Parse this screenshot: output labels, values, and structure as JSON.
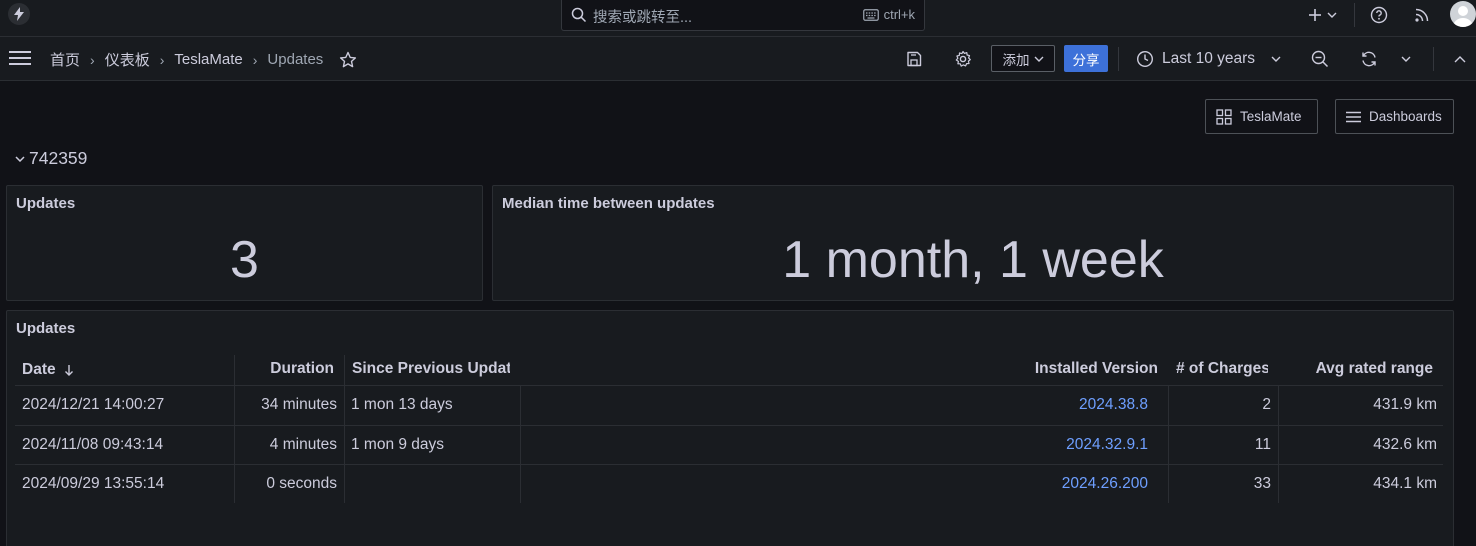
{
  "topbar": {
    "search_placeholder": "搜索或跳转至...",
    "search_shortcut": "ctrl+k"
  },
  "breadcrumbs": [
    "首页",
    "仪表板",
    "TeslaMate",
    "Updates"
  ],
  "toolbar": {
    "add_label": "添加",
    "share_label": "分享",
    "time_range": "Last 10 years"
  },
  "dashboard_links": {
    "teslamate": "TeslaMate",
    "dashboards": "Dashboards"
  },
  "row_title": "742359",
  "stat_updates": {
    "title": "Updates",
    "value": "3"
  },
  "stat_median": {
    "title": "Median time between updates",
    "value": "1 month, 1 week"
  },
  "table": {
    "title": "Updates",
    "headers": {
      "date": "Date",
      "duration": "Duration",
      "since_previous": "Since Previous Updat",
      "installed_version": "Installed Version",
      "charges": "# of Charges",
      "avg_range": "Avg rated range"
    },
    "rows": [
      {
        "date": "2024/12/21 14:00:27",
        "duration": "34 minutes",
        "since_previous": "1 mon 13 days",
        "version": "2024.38.8",
        "charges": "2",
        "range": "431.9 km"
      },
      {
        "date": "2024/11/08 09:43:14",
        "duration": "4 minutes",
        "since_previous": "1 mon 9 days",
        "version": "2024.32.9.1",
        "charges": "11",
        "range": "432.6 km"
      },
      {
        "date": "2024/09/29 13:55:14",
        "duration": "0 seconds",
        "since_previous": "",
        "version": "2024.26.200",
        "charges": "33",
        "range": "434.1 km"
      }
    ]
  },
  "colors": {
    "background": "#111217",
    "panel": "#181b1f",
    "border": "#2b2e33",
    "primary_button": "#3d71d9",
    "link": "#6e9fff",
    "text": "#ccccdc"
  }
}
